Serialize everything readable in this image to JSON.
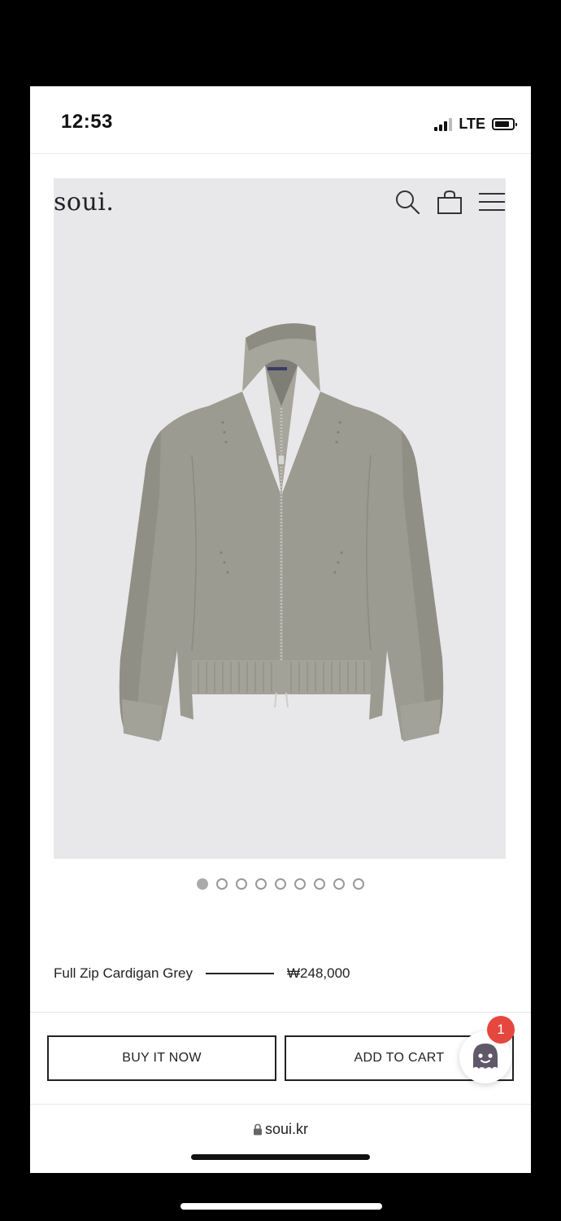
{
  "status_bar": {
    "time": "12:53",
    "network": "LTE"
  },
  "header": {
    "logo": "soui.",
    "icons": [
      "search-icon",
      "bag-icon",
      "menu-icon"
    ]
  },
  "carousel": {
    "total": 9,
    "active_index": 0
  },
  "product": {
    "name": "Full Zip Cardigan Grey",
    "price": "₩248,000",
    "image_color": "#9a9a90"
  },
  "actions": {
    "buy_now": "BUY IT NOW",
    "add_to_cart": "ADD TO CART"
  },
  "chat": {
    "badge_count": "1"
  },
  "browser": {
    "url": "soui.kr"
  }
}
